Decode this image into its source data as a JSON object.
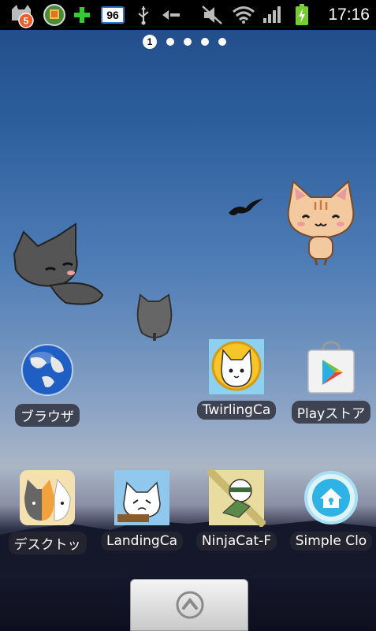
{
  "status_bar": {
    "notification_count": "5",
    "battery_level_badge": "96",
    "time": "17:16",
    "icons": [
      "cat-notification-icon",
      "app-update-icon",
      "plus-icon",
      "battery-96-badge-icon",
      "usb-icon",
      "sync-arrow-icon",
      "muted-icon",
      "wifi-icon",
      "signal-icon",
      "charging-battery-icon"
    ]
  },
  "home": {
    "page_indicator": {
      "active_page": "1",
      "total_pages": 5
    },
    "apps_row1": [
      {
        "label": "ブラウザ",
        "icon": "globe-icon"
      },
      {
        "label": "TwirlingCa",
        "icon": "twirling-cat-icon"
      },
      {
        "label": "Playストア",
        "icon": "play-store-icon"
      }
    ],
    "apps_row2": [
      {
        "label": "デスクトッ",
        "icon": "desktop-cats-icon"
      },
      {
        "label": "LandingCa",
        "icon": "landing-cat-icon"
      },
      {
        "label": "NinjaCat-F",
        "icon": "ninja-cat-icon"
      },
      {
        "label": "Simple Clo",
        "icon": "simple-cleaner-icon"
      }
    ]
  },
  "colors": {
    "status_bar_bg": "#000000",
    "accent_green": "#33cc33"
  }
}
